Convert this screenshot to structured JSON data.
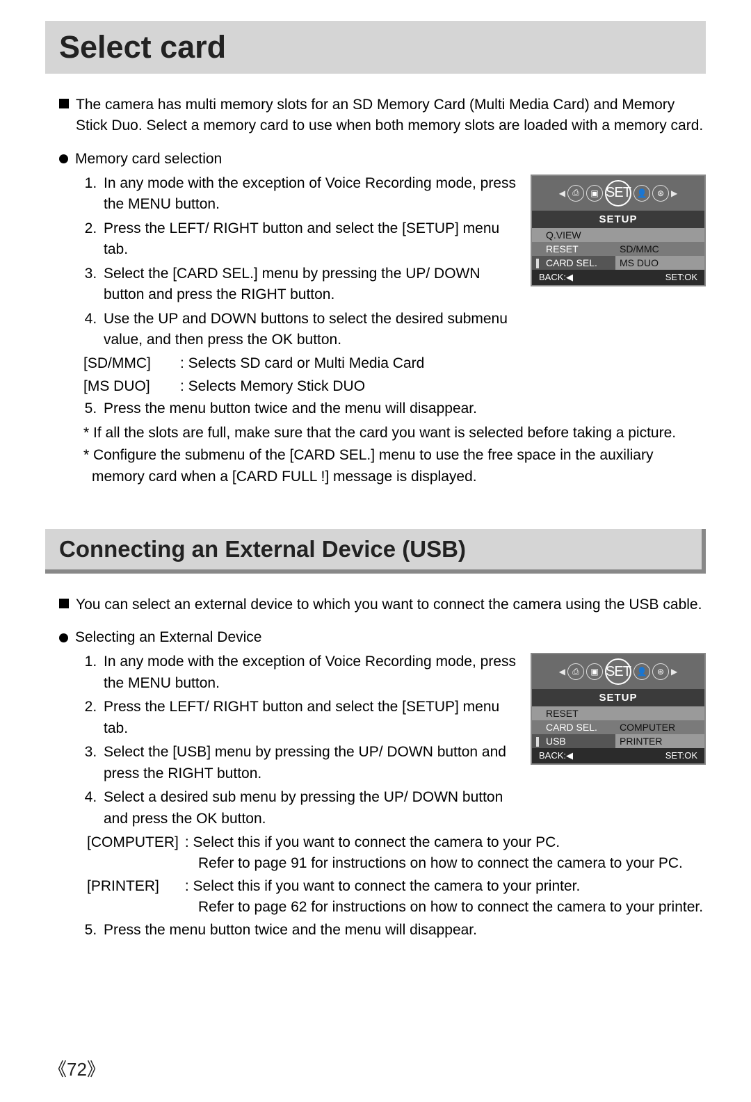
{
  "titles": {
    "main": "Select card",
    "usb": "Connecting an External Device (USB)"
  },
  "sec1": {
    "intro": "The camera has multi memory slots for an SD Memory Card (Multi Media Card) and Memory Stick Duo. Select a memory card to use when both memory slots are loaded with a memory card.",
    "bullet": "Memory card selection",
    "steps": {
      "s1": "In any mode with the exception of Voice Recording mode, press the MENU button.",
      "s2": "Press the LEFT/ RIGHT button and select the [SETUP] menu tab.",
      "s3": "Select the [CARD SEL.] menu by pressing the UP/ DOWN button and press the RIGHT button.",
      "s4": "Use the UP and DOWN buttons to select the desired submenu value, and then press the OK button.",
      "s5": "Press the menu button twice and the menu will disappear."
    },
    "opts": {
      "o1_name": "[SD/MMC]",
      "o1_desc": ": Selects SD card or Multi Media Card",
      "o2_name": "[MS DUO]",
      "o2_desc": ": Selects Memory Stick DUO"
    },
    "notes": {
      "n1": "* If all the slots are full, make sure that the card you want is selected before taking a picture.",
      "n2": "* Configure the submenu of the [CARD SEL.] menu to use the free space in the auxiliary memory card when a [CARD FULL !] message is displayed."
    }
  },
  "sec2": {
    "intro": "You can select an external device to which you want to connect the camera using the USB cable.",
    "bullet": "Selecting an External Device",
    "steps": {
      "s1": "In any mode with the exception of Voice Recording mode, press the MENU button.",
      "s2": "Press the LEFT/ RIGHT button and select the [SETUP] menu tab.",
      "s3": "Select the [USB] menu by pressing the UP/ DOWN button and press the RIGHT button.",
      "s4": "Select a desired sub menu by pressing the UP/ DOWN button and press the OK button.",
      "s5": "Press the menu button twice and the menu will disappear."
    },
    "opts": {
      "o1_name": "[COMPUTER]",
      "o1_desc": ": Select this if you want to connect the camera to your PC.",
      "o1_sub": "Refer to page 91 for instructions on how to connect the camera to your PC.",
      "o2_name": "[PRINTER]",
      "o2_desc": ": Select this if you want to connect the camera to your printer.",
      "o2_sub": "Refer to page 62 for instructions on how to connect the camera to your printer."
    }
  },
  "lcd1": {
    "tab": "SET",
    "head": "SETUP",
    "m1": "Q.VIEW",
    "m2": "RESET",
    "m2r": "SD/MMC",
    "m3": "CARD SEL.",
    "m3r": "MS DUO",
    "back": "BACK:◀",
    "set": "SET:OK"
  },
  "lcd2": {
    "tab": "SET",
    "head": "SETUP",
    "m1": "RESET",
    "m2": "CARD SEL.",
    "m2r": "COMPUTER",
    "m3": "USB",
    "m3r": "PRINTER",
    "back": "BACK:◀",
    "set": "SET:OK"
  },
  "page": "72"
}
